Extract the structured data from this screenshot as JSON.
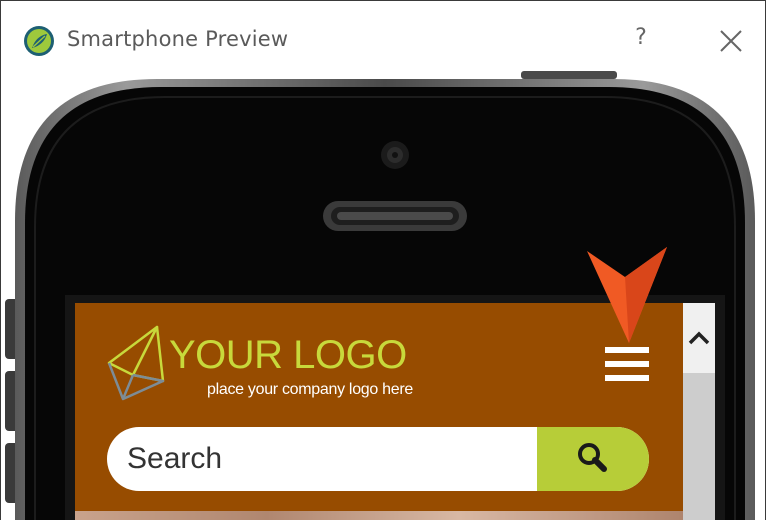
{
  "window": {
    "title": "Smartphone Preview",
    "help_label": "?",
    "icons": {
      "app": "leaf-icon",
      "close": "close-icon"
    }
  },
  "site": {
    "logo_text": "YOUR LOGO",
    "logo_tagline": "place your company logo here",
    "search_placeholder": "Search",
    "icons": {
      "menu": "hamburger-menu-icon",
      "search": "magnifier-icon",
      "pointer": "arrow-pointer-icon",
      "scroll_up": "chevron-up-icon"
    },
    "colors": {
      "header_bg": "#974c00",
      "logo": "#c8d93b",
      "search_button": "#b7cd38",
      "pointer": "#f05a24"
    }
  }
}
